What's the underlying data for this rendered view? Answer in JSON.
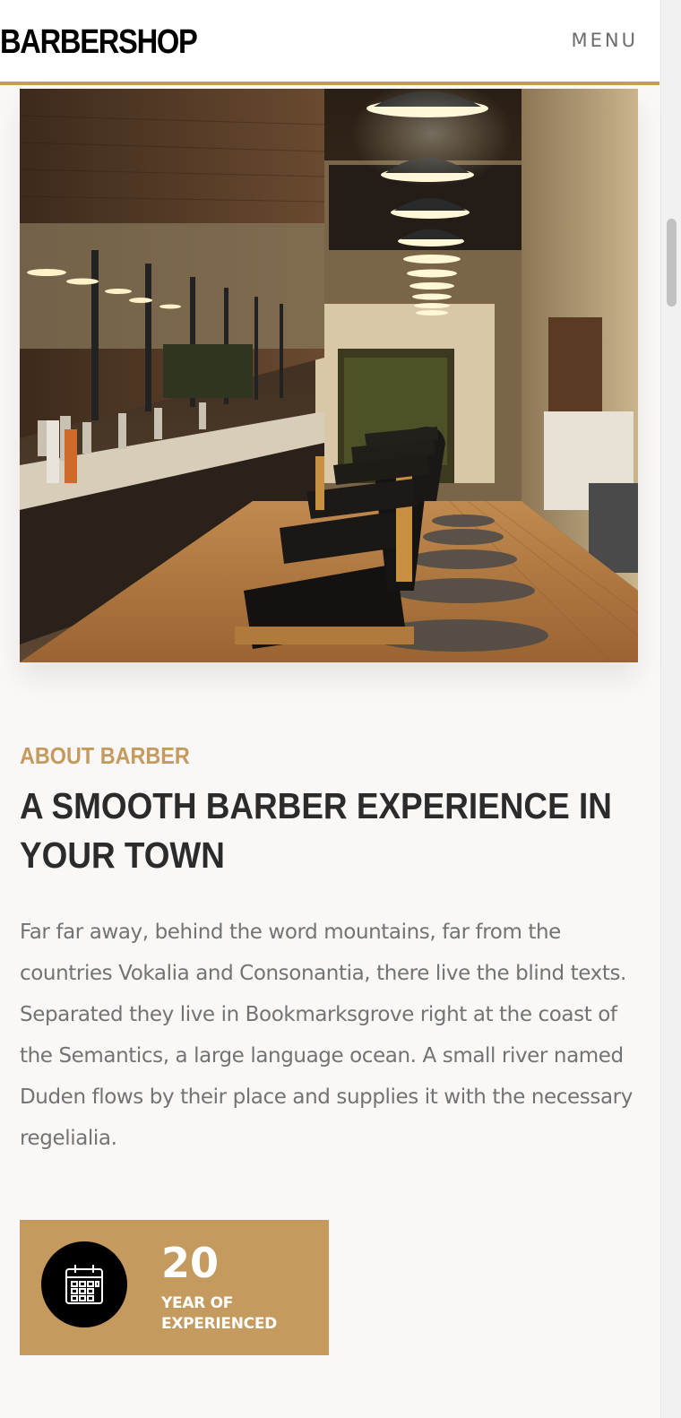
{
  "navbar": {
    "brand": "BARBERSHOP",
    "menu_label": "MENU"
  },
  "hero": {
    "image_icon": "barbershop-interior-photo"
  },
  "about": {
    "subtitle": "ABOUT BARBER",
    "heading": "A SMOOTH BARBER EXPERIENCE IN YOUR TOWN",
    "body": "Far far away, behind the word mountains, far from the countries Vokalia and Consonantia, there live the blind texts. Separated they live in Bookmarksgrove right at the coast of the Semantics, a large language ocean. A small river named Duden flows by their place and supplies it with the necessary regelialia."
  },
  "stat": {
    "icon": "calendar-icon",
    "number": "20",
    "label": "YEAR OF EXPERIENCED"
  },
  "colors": {
    "accent": "#c49a5e",
    "heading": "#2b2b2b",
    "body_text": "#737373",
    "background": "#faf8f6"
  }
}
